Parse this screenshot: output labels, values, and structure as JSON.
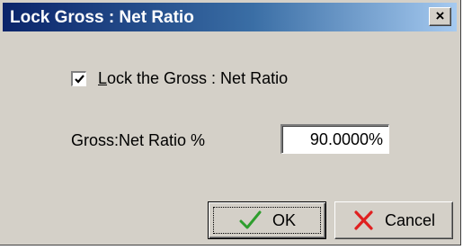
{
  "window": {
    "title": "Lock Gross : Net Ratio",
    "close_glyph": "×",
    "close_icon": "close-icon"
  },
  "form": {
    "lock_checkbox": {
      "label": "Lock the Gross : Net Ratio",
      "checked": true,
      "icon": "checkmark-icon"
    },
    "ratio_field": {
      "label": "Gross:Net Ratio %",
      "value": "90.0000%"
    }
  },
  "buttons": {
    "ok": {
      "label": "OK",
      "icon": "green-check-icon",
      "icon_color": "#2e9e2e"
    },
    "cancel": {
      "label": "Cancel",
      "icon": "red-x-icon",
      "icon_color": "#e02020"
    }
  },
  "colors": {
    "titlebar_start": "#0a246a",
    "titlebar_end": "#a6caf0",
    "dialog_face": "#d4d0c8"
  }
}
